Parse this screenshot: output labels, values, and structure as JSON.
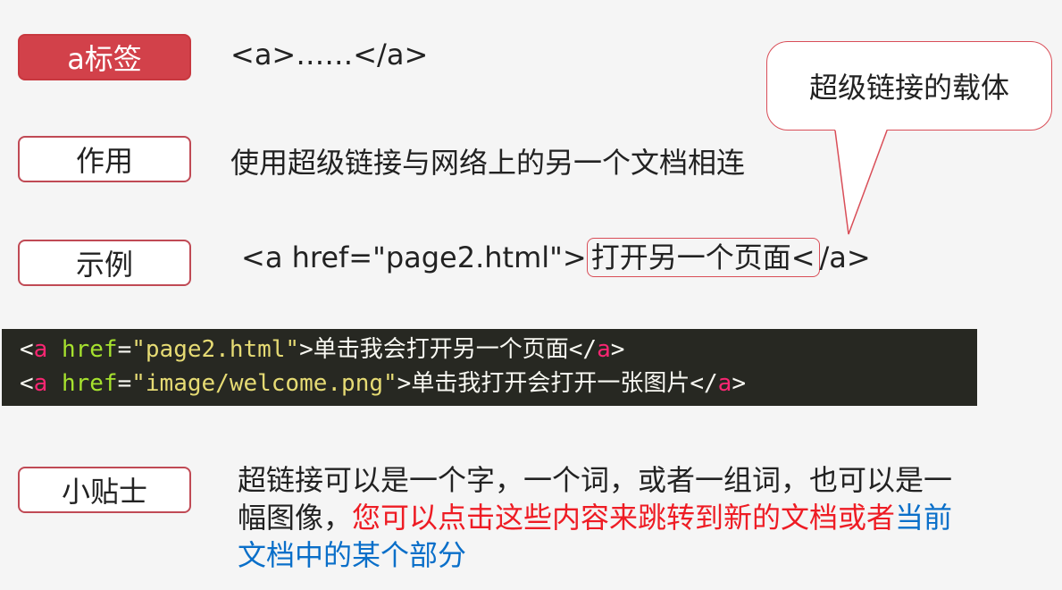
{
  "labels": {
    "a_tag": "a标签",
    "purpose": "作用",
    "example": "示例",
    "tip": "小贴士"
  },
  "a_tag_syntax": "<a>……</a>",
  "purpose_text": "使用超级链接与网络上的另一个文档相连",
  "example_line": {
    "prefix": "<a href=\"page2.html\">",
    "highlighted": "打开另一个页面<",
    "suffix": "/a>"
  },
  "callout": "超级链接的载体",
  "code": {
    "line1": {
      "open": "<",
      "tag": "a",
      "attr": "href",
      "eq": "=",
      "value": "\"page2.html\"",
      "close": ">",
      "text": "单击我会打开另一个页面",
      "end_open": "</",
      "end_tag": "a",
      "end_close": ">"
    },
    "line2": {
      "open": "<",
      "tag": "a",
      "attr": "href",
      "eq": "=",
      "value": "\"image/welcome.png\"",
      "close": ">",
      "text": "单击我打开会打开一张图片",
      "end_open": "</",
      "end_tag": "a",
      "end_close": ">"
    }
  },
  "tip_text": {
    "normal": "超链接可以是一个字，一个词，或者一组词，也可以是一幅图像，",
    "red": "您可以点击这些内容来跳转到新的文档或者",
    "blue": "当前文档中的某个部分"
  },
  "colors": {
    "tag_fill": "#d2414a",
    "outline": "#c04a55",
    "callout_border": "#d94e58",
    "code_bg": "#272822",
    "code_tag": "#f92672",
    "code_attr": "#a6e22e",
    "code_string": "#e6db74",
    "tip_red": "#ee1c24",
    "tip_blue": "#0a6fc9"
  }
}
